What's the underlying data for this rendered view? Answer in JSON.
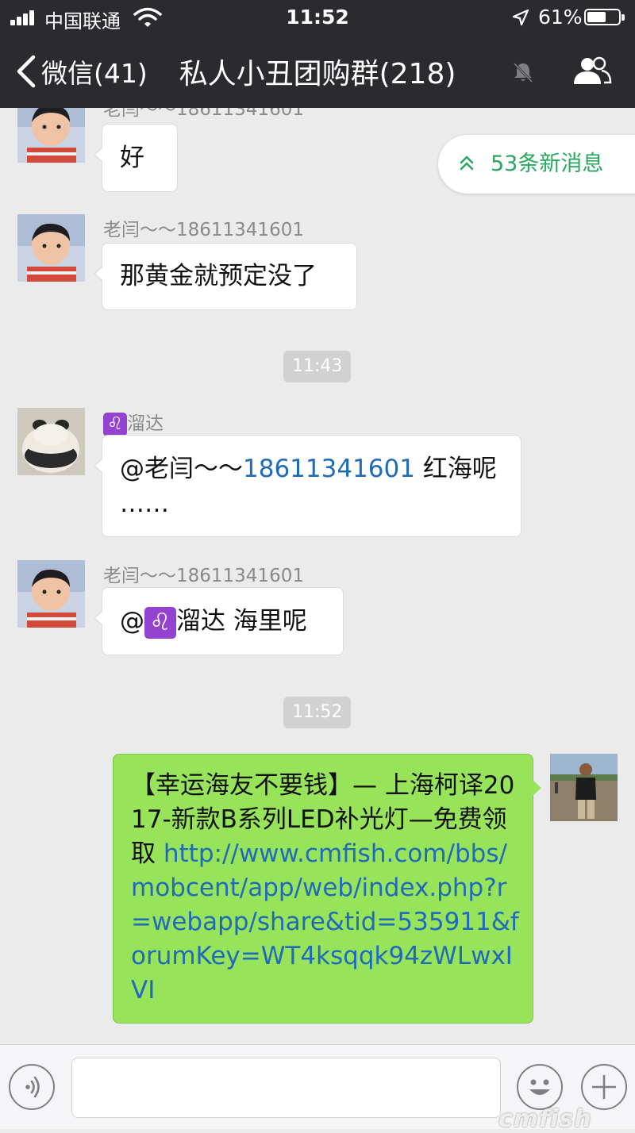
{
  "status_bar": {
    "carrier": "中国联通",
    "time": "11:52",
    "battery_percent": "61%",
    "battery_level": 0.61
  },
  "nav": {
    "back_label": "微信(41)",
    "title": "私人小丑团购群(218)"
  },
  "new_messages_pill": "53条新消息",
  "messages": [
    {
      "sender": "老闫～～18611341601",
      "text": "好"
    },
    {
      "sender": "老闫～～18611341601",
      "text": "那黄金就预定没了"
    },
    {
      "time": "11:43"
    },
    {
      "sender_icon": "♌",
      "sender_name": "溜达",
      "mention": "@老闫～～",
      "phone_link": "18611341601",
      "text_after": " 红海呢",
      "text_line2": "……"
    },
    {
      "sender": "老闫～～18611341601",
      "mention_prefix": "@",
      "mention_icon": "♌",
      "mention_name": "溜达",
      "text_after": " 海里呢"
    },
    {
      "time": "11:52"
    },
    {
      "outgoing": true,
      "text": "【幸运海友不要钱】— 上海柯译2017-新款B系列LED补光灯—免费领取 ",
      "link": "http://www.cmfish.com/bbs/mobcent/app/web/index.php?r=webapp/share&tid=535911&forumKey=WT4ksqqk94zWLwxIVI"
    }
  ],
  "input": {
    "value": ""
  },
  "watermark": "cmfish",
  "colors": {
    "header_bg": "#2b2b2f",
    "chat_bg": "#ebebeb",
    "outgoing_bubble": "#97e35a",
    "link": "#1f6bb9",
    "new_msg_green": "#27a85c",
    "leo_badge": "#9343cf"
  },
  "icons": [
    "signal-icon",
    "wifi-icon",
    "location-arrow-icon",
    "battery-icon",
    "back-chevron-icon",
    "mute-bell-icon",
    "group-members-icon",
    "double-chevron-up-icon",
    "voice-input-icon",
    "emoji-icon",
    "add-icon"
  ]
}
